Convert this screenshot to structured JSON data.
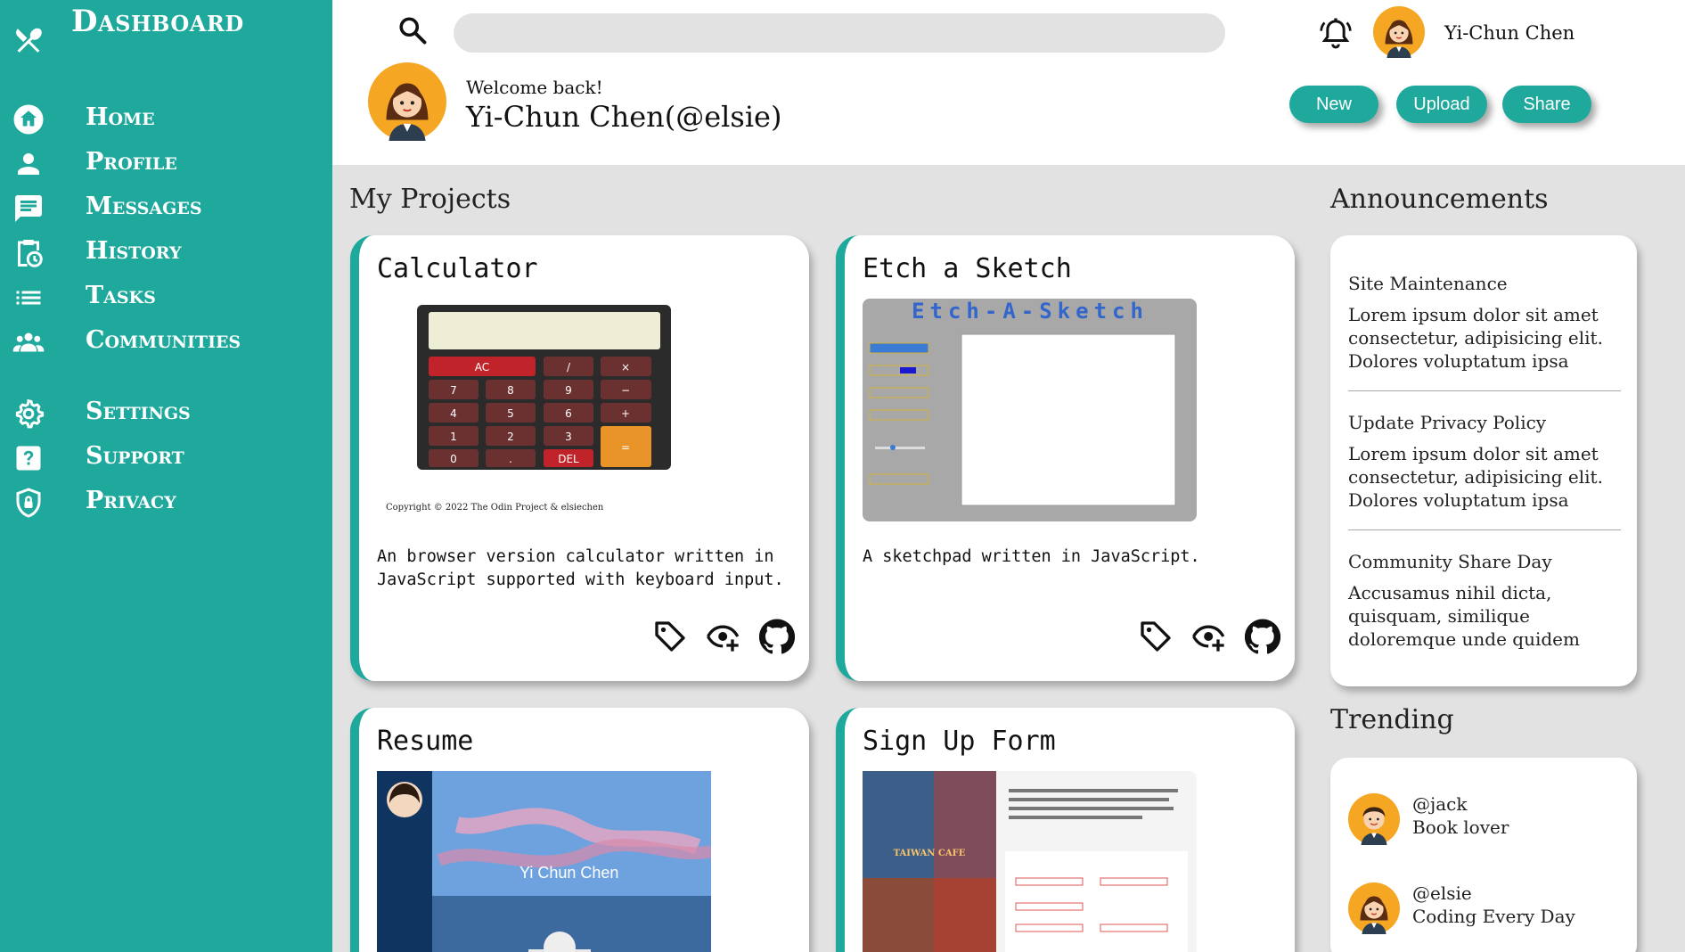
{
  "colors": {
    "accent": "#1fa99d",
    "background": "#e2e2e2",
    "card": "#ffffff"
  },
  "sidebar": {
    "brand": "Dashboard",
    "items": [
      {
        "label": "Home",
        "icon": "home-icon"
      },
      {
        "label": "Profile",
        "icon": "person-icon"
      },
      {
        "label": "Messages",
        "icon": "message-icon"
      },
      {
        "label": "History",
        "icon": "history-icon"
      },
      {
        "label": "Tasks",
        "icon": "list-icon"
      },
      {
        "label": "Communities",
        "icon": "people-icon"
      },
      {
        "label": "Settings",
        "icon": "gear-icon"
      },
      {
        "label": "Support",
        "icon": "help-icon"
      },
      {
        "label": "Privacy",
        "icon": "shield-icon"
      }
    ]
  },
  "header": {
    "search_value": "",
    "user_name": "Yi-Chun Chen",
    "welcome_line": "Welcome back!",
    "welcome_name": "Yi-Chun Chen(@elsie)",
    "buttons": {
      "new": "New",
      "upload": "Upload",
      "share": "Share"
    }
  },
  "projects": {
    "title": "My Projects",
    "items": [
      {
        "title": "Calculator",
        "description": "An browser version calculator written in JavaScript supported with keyboard input.",
        "preview": {
          "keys": [
            "AC",
            "/",
            "×",
            "7",
            "8",
            "9",
            "−",
            "4",
            "5",
            "6",
            "+",
            "1",
            "2",
            "3",
            "0",
            ".",
            "DEL",
            "="
          ],
          "copyright": "Copyright © 2022 The Odin Project & elsiechen"
        }
      },
      {
        "title": "Etch a Sketch",
        "description": "A sketchpad written in JavaScript.",
        "preview": {
          "heading": "Etch-A-Sketch"
        }
      },
      {
        "title": "Resume",
        "description": "",
        "preview": {
          "name": "Yi Chun Chen"
        }
      },
      {
        "title": "Sign Up Form",
        "description": "",
        "preview": {
          "logo": "TAIWAN CAFE"
        }
      }
    ]
  },
  "announcements": {
    "title": "Announcements",
    "items": [
      {
        "title": "Site Maintenance",
        "body": "Lorem ipsum dolor sit amet consectetur, adipisicing elit. Dolores voluptatum ipsa"
      },
      {
        "title": "Update Privacy Policy",
        "body": "Lorem ipsum dolor sit amet consectetur, adipisicing elit. Dolores voluptatum ipsa"
      },
      {
        "title": "Community Share Day",
        "body": "Accusamus nihil dicta, quisquam, similique doloremque unde quidem"
      }
    ]
  },
  "trending": {
    "title": "Trending",
    "items": [
      {
        "handle": "@jack",
        "bio": "Book lover"
      },
      {
        "handle": "@elsie",
        "bio": "Coding Every Day"
      }
    ]
  }
}
